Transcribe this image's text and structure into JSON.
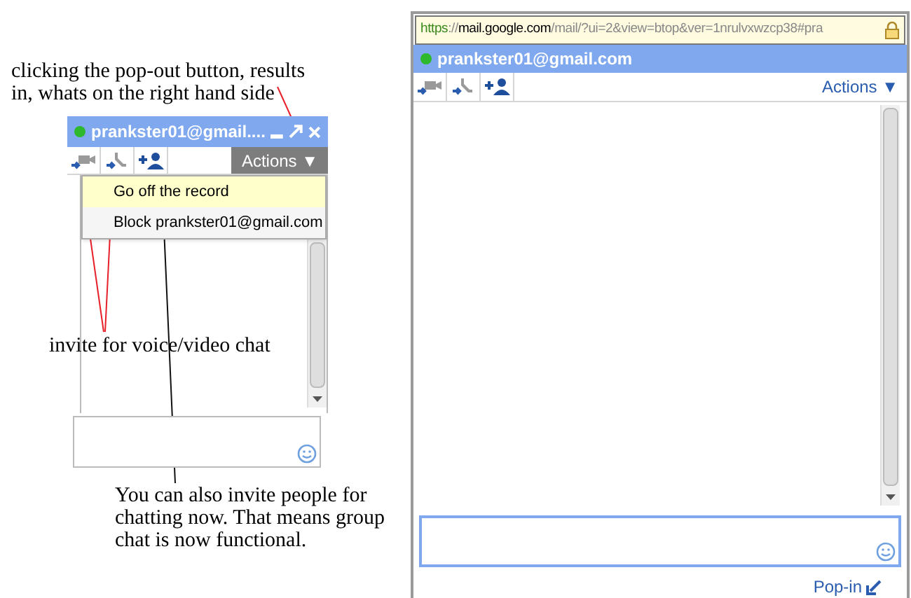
{
  "notes": [
    {
      "text": "clicking the pop-out button, results in, whats on the right hand side"
    },
    {
      "text": "invite for voice/video chat"
    },
    {
      "text": "You can also invite people for chatting now. That means group chat is now functional."
    }
  ],
  "docked_chat": {
    "title": "prankster01@gmail....",
    "online": true,
    "actions": "Actions ▼",
    "actions_open": true,
    "menu": [
      {
        "label": "Go off the record",
        "selected": true
      },
      {
        "label": "Block prankster01@gmail.com",
        "selected": false
      }
    ]
  },
  "popout_window": {
    "url": {
      "scheme": "https",
      "separator": "://",
      "host": "mail.google.com",
      "path": "/mail/?ui=2&view=btop&ver=1nrulvxwzcp38#pra"
    },
    "title": "prankster01@gmail.com",
    "online": true,
    "actions": "Actions ▼",
    "pop_in": "Pop-in"
  }
}
